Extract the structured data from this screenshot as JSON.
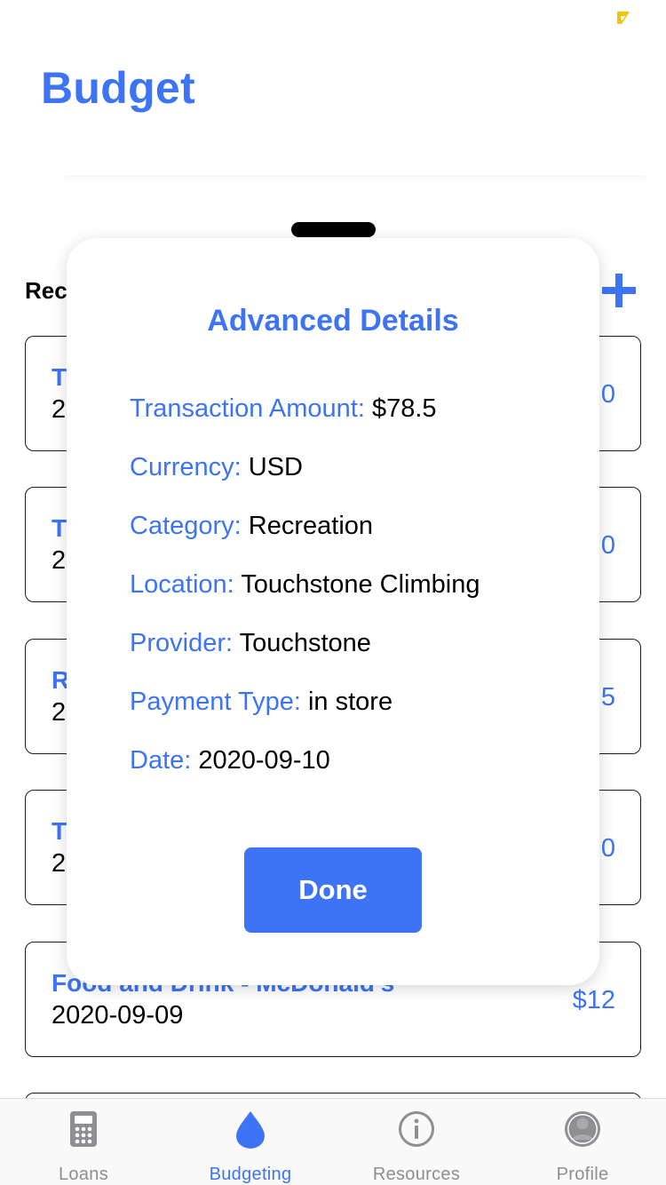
{
  "colors": {
    "accent": "#3d74f5",
    "status_indicator": "#f5c400",
    "inactive_tab": "#8e8e93"
  },
  "header": {
    "title": "Budget"
  },
  "section": {
    "title": "Recent Transactions",
    "add_icon": "plus-icon"
  },
  "transactions": [
    {
      "title": "T",
      "date": "2",
      "amount": "0"
    },
    {
      "title": "T",
      "date": "2",
      "amount": "0"
    },
    {
      "title": "R",
      "date": "2",
      "amount": "5"
    },
    {
      "title": "T",
      "date": "2",
      "amount": "0"
    },
    {
      "title": "Food and Drink - McDonald's",
      "date": "2020-09-09",
      "amount": "$12"
    }
  ],
  "modal": {
    "title": "Advanced Details",
    "rows": [
      {
        "label": "Transaction Amount:",
        "value": "$78.5"
      },
      {
        "label": "Currency:",
        "value": "USD"
      },
      {
        "label": "Category:",
        "value": "Recreation"
      },
      {
        "label": "Location:",
        "value": "Touchstone Climbing"
      },
      {
        "label": "Provider:",
        "value": "Touchstone"
      },
      {
        "label": "Payment Type:",
        "value": "in store"
      },
      {
        "label": "Date:",
        "value": "2020-09-10"
      }
    ],
    "done_label": "Done"
  },
  "tabs": [
    {
      "label": "Loans",
      "icon": "calculator-icon",
      "active": false
    },
    {
      "label": "Budgeting",
      "icon": "drop-icon",
      "active": true
    },
    {
      "label": "Resources",
      "icon": "info-icon",
      "active": false
    },
    {
      "label": "Profile",
      "icon": "person-icon",
      "active": false
    }
  ]
}
